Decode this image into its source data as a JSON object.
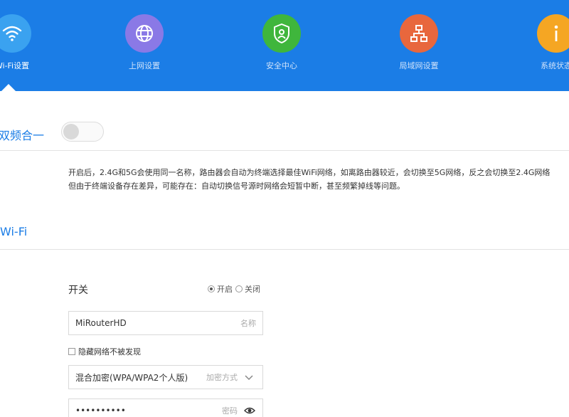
{
  "nav": {
    "items": [
      {
        "label": "Wi-Fi设置",
        "icon": "wifi-icon",
        "color": "#3aa2f0"
      },
      {
        "label": "上网设置",
        "icon": "globe-icon",
        "color": "#8a79e6"
      },
      {
        "label": "安全中心",
        "icon": "shield-icon",
        "color": "#3fb63c"
      },
      {
        "label": "局域网设置",
        "icon": "lan-icon",
        "color": "#e8673d"
      },
      {
        "label": "系统状态",
        "icon": "info-icon",
        "color": "#f5a623"
      }
    ],
    "active_index": 0,
    "background": "#1b7de6"
  },
  "dual_band": {
    "title": "双频合一",
    "enabled": false,
    "description_line1": "开启后，2.4G和5G会使用同一名称，路由器会自动为终端选择最佳WiFi网络，如离路由器较近，会切换至5G网络，反之会切换至2.4G网络",
    "description_line2": "但由于终端设备存在差异，可能存在：自动切换信号源时网络会短暂中断，甚至频繁掉线等问题。"
  },
  "wifi": {
    "title": "Wi-Fi",
    "switch_label": "开关",
    "radio_on": "开启",
    "radio_off": "关闭",
    "radio_selected": "on",
    "name_value": "MiRouterHD",
    "name_hint": "名称",
    "hide_network_label": "隐藏网络不被发现",
    "hide_network_checked": false,
    "encryption_value": "混合加密(WPA/WPA2个人版)",
    "encryption_hint": "加密方式",
    "password_value": "••••••••••",
    "password_hint": "密码"
  },
  "accent_color": "#1b7de6"
}
